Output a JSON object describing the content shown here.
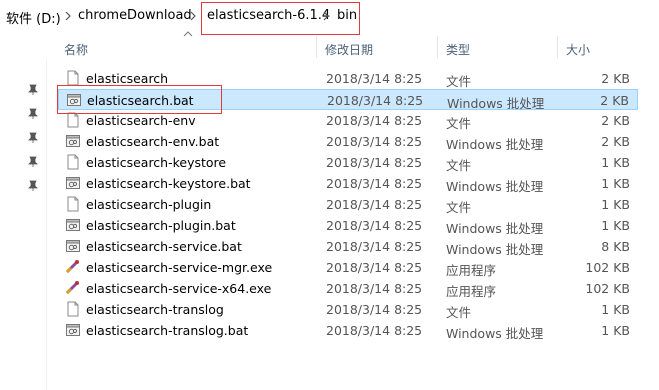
{
  "breadcrumb": {
    "items": [
      {
        "label": "软件 (D:)"
      },
      {
        "label": "chromeDownload"
      },
      {
        "label": "elasticsearch-6.1.4"
      },
      {
        "label": "bin"
      }
    ]
  },
  "columns": {
    "name": "名称",
    "date": "修改日期",
    "type": "类型",
    "size": "大小"
  },
  "files": [
    {
      "name": "elasticsearch",
      "date": "2018/3/14 8:25",
      "type": "文件",
      "size": "2 KB",
      "icon": "file-icon"
    },
    {
      "name": "elasticsearch.bat",
      "date": "2018/3/14 8:25",
      "type": "Windows 批处理",
      "size": "2 KB",
      "icon": "batch-file-icon"
    },
    {
      "name": "elasticsearch-env",
      "date": "2018/3/14 8:25",
      "type": "文件",
      "size": "2 KB",
      "icon": "file-icon"
    },
    {
      "name": "elasticsearch-env.bat",
      "date": "2018/3/14 8:25",
      "type": "Windows 批处理",
      "size": "2 KB",
      "icon": "batch-file-icon"
    },
    {
      "name": "elasticsearch-keystore",
      "date": "2018/3/14 8:25",
      "type": "文件",
      "size": "1 KB",
      "icon": "file-icon"
    },
    {
      "name": "elasticsearch-keystore.bat",
      "date": "2018/3/14 8:25",
      "type": "Windows 批处理",
      "size": "1 KB",
      "icon": "batch-file-icon"
    },
    {
      "name": "elasticsearch-plugin",
      "date": "2018/3/14 8:25",
      "type": "文件",
      "size": "1 KB",
      "icon": "file-icon"
    },
    {
      "name": "elasticsearch-plugin.bat",
      "date": "2018/3/14 8:25",
      "type": "Windows 批处理",
      "size": "1 KB",
      "icon": "batch-file-icon"
    },
    {
      "name": "elasticsearch-service.bat",
      "date": "2018/3/14 8:25",
      "type": "Windows 批处理",
      "size": "8 KB",
      "icon": "batch-file-icon"
    },
    {
      "name": "elasticsearch-service-mgr.exe",
      "date": "2018/3/14 8:25",
      "type": "应用程序",
      "size": "102 KB",
      "icon": "application-icon"
    },
    {
      "name": "elasticsearch-service-x64.exe",
      "date": "2018/3/14 8:25",
      "type": "应用程序",
      "size": "102 KB",
      "icon": "application-icon"
    },
    {
      "name": "elasticsearch-translog",
      "date": "2018/3/14 8:25",
      "type": "文件",
      "size": "1 KB",
      "icon": "file-icon"
    },
    {
      "name": "elasticsearch-translog.bat",
      "date": "2018/3/14 8:25",
      "type": "Windows 批处理",
      "size": "1 KB",
      "icon": "batch-file-icon"
    }
  ],
  "selected_index": 1,
  "colors": {
    "selection_bg": "#cce8ff",
    "selection_border": "#99d1ff",
    "header_text": "#4c607a",
    "annotation_red": "#e03a3a"
  }
}
